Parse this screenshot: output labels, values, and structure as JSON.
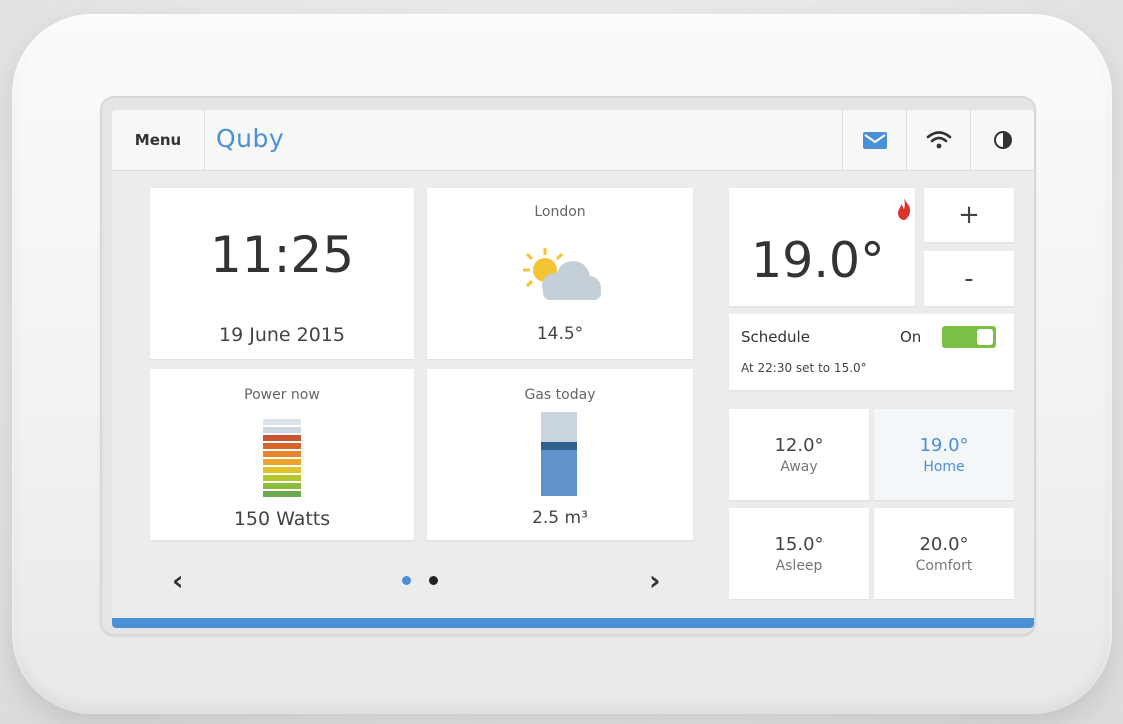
{
  "header": {
    "menu_label": "Menu",
    "logo_text": "Quby",
    "icons": [
      "mail-icon",
      "wifi-icon",
      "contrast-icon"
    ]
  },
  "clock": {
    "time": "11:25",
    "date": "19 June 2015"
  },
  "weather": {
    "city": "London",
    "temperature": "14.5°",
    "icon": "partly-cloudy-icon"
  },
  "power": {
    "label": "Power now",
    "value": "150 Watts"
  },
  "gas": {
    "label": "Gas today",
    "value": "2.5 m³"
  },
  "pager": {
    "prev": "‹",
    "next": "›",
    "active_page": 1,
    "pages": 2
  },
  "thermostat": {
    "current_temp": "19.0°",
    "heating_icon": "flame-icon",
    "increase_label": "+",
    "decrease_label": "-",
    "schedule_label": "Schedule",
    "schedule_state": "On",
    "schedule_note": "At 22:30 set to 15.0°"
  },
  "presets": [
    {
      "temp": "12.0°",
      "name": "Away"
    },
    {
      "temp": "19.0°",
      "name": "Home",
      "active": true
    },
    {
      "temp": "15.0°",
      "name": "Asleep"
    },
    {
      "temp": "20.0°",
      "name": "Comfort"
    }
  ],
  "colors": {
    "accent": "#4a90d6",
    "toggle_on": "#7bbf45",
    "flame": "#d9332b",
    "power_levels": [
      "#6aa84f",
      "#8bbd3a",
      "#b5c72d",
      "#e2c22b",
      "#eea32a",
      "#e8862d",
      "#d9652d",
      "#c9542d"
    ],
    "gas_fill": "#5f93c9"
  }
}
